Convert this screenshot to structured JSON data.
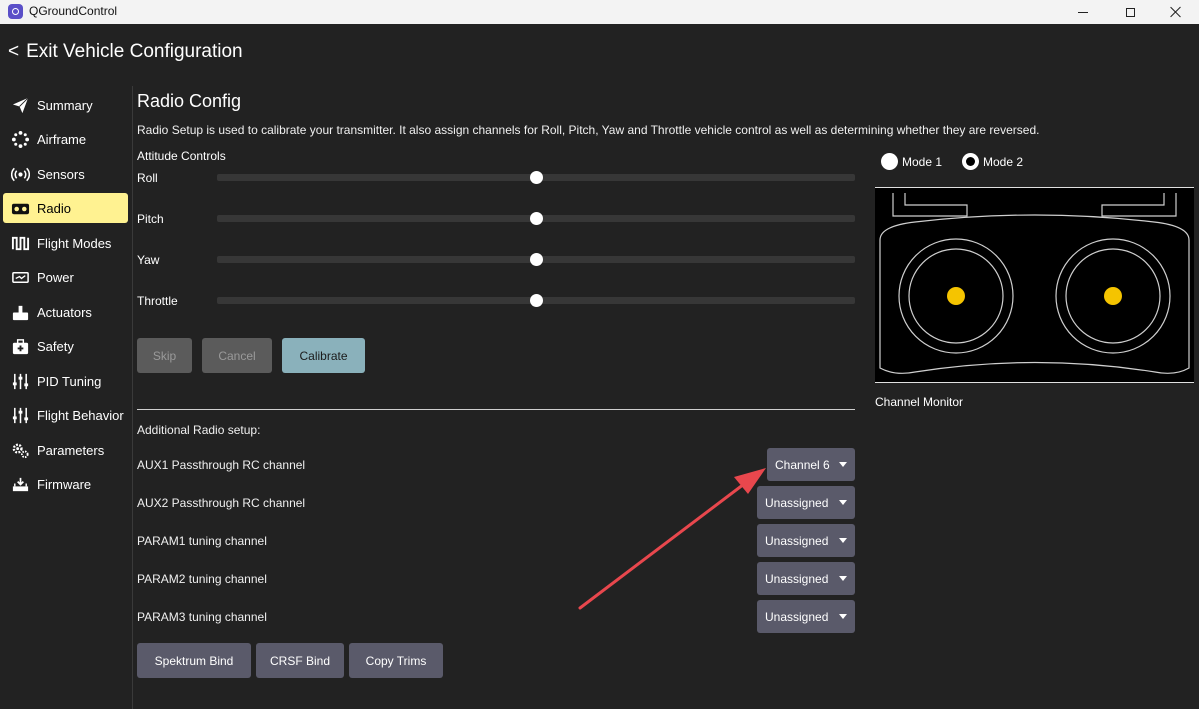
{
  "window": {
    "title": "QGroundControl"
  },
  "header": {
    "exit_prefix": "<",
    "exit_label": "Exit Vehicle Configuration"
  },
  "sidebar": {
    "items": [
      {
        "label": "Summary",
        "icon": "paper-plane-icon"
      },
      {
        "label": "Airframe",
        "icon": "airframe-icon"
      },
      {
        "label": "Sensors",
        "icon": "sensors-icon"
      },
      {
        "label": "Radio",
        "icon": "radio-icon",
        "active": true
      },
      {
        "label": "Flight Modes",
        "icon": "flight-modes-icon"
      },
      {
        "label": "Power",
        "icon": "power-icon"
      },
      {
        "label": "Actuators",
        "icon": "actuators-icon"
      },
      {
        "label": "Safety",
        "icon": "safety-icon"
      },
      {
        "label": "PID Tuning",
        "icon": "sliders-icon"
      },
      {
        "label": "Flight Behavior",
        "icon": "sliders-icon"
      },
      {
        "label": "Parameters",
        "icon": "gears-icon"
      },
      {
        "label": "Firmware",
        "icon": "firmware-icon"
      }
    ]
  },
  "main": {
    "title": "Radio Config",
    "description": "Radio Setup is used to calibrate your transmitter. It also assign channels for Roll, Pitch, Yaw and Throttle vehicle control as well as determining whether they are reversed.",
    "attitude_title": "Attitude Controls",
    "sliders": [
      {
        "label": "Roll",
        "level": 0.5
      },
      {
        "label": "Pitch",
        "level": 0.5
      },
      {
        "label": "Yaw",
        "level": 0.5
      },
      {
        "label": "Throttle",
        "level": 0.5
      }
    ],
    "buttons": {
      "skip": "Skip",
      "cancel": "Cancel",
      "calibrate": "Calibrate"
    },
    "additional_title": "Additional Radio setup:",
    "channels": [
      {
        "label": "AUX1 Passthrough RC channel",
        "value": "Channel 6"
      },
      {
        "label": "AUX2 Passthrough RC channel",
        "value": "Unassigned"
      },
      {
        "label": "PARAM1 tuning channel",
        "value": "Unassigned"
      },
      {
        "label": "PARAM2 tuning channel",
        "value": "Unassigned"
      },
      {
        "label": "PARAM3 tuning channel",
        "value": "Unassigned"
      }
    ],
    "bottom_buttons": {
      "spektrum": "Spektrum Bind",
      "crsf": "CRSF Bind",
      "copy_trims": "Copy Trims"
    }
  },
  "monitor": {
    "mode1": "Mode 1",
    "mode2": "Mode 2",
    "selected_mode": "Mode 2",
    "label": "Channel Monitor",
    "stick_color": "#f5c400"
  },
  "colors": {
    "active_nav": "#fff291",
    "calibrate": "#8ab1bb",
    "dropdown": "#5a5a6a",
    "annotation_arrow": "#e8474d"
  }
}
